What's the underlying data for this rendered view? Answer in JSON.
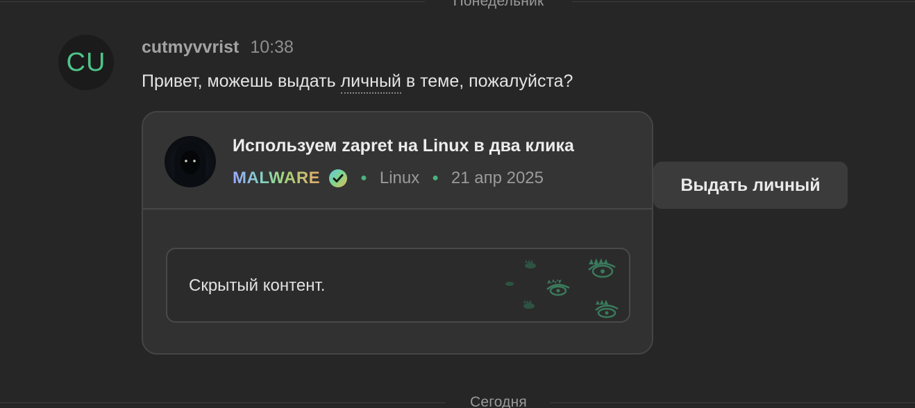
{
  "dividers": {
    "top": "Понедельник",
    "bottom": "Сегодня"
  },
  "message": {
    "avatar_initials": "CU",
    "author": "cutmyvvrist",
    "time": "10:38",
    "text_before": "Привет, можешь выдать ",
    "text_highlight": "личный",
    "text_after": " в теме, пожалуйста?"
  },
  "thread_card": {
    "title": "Используем zapret на Linux в два клика",
    "author": "MALWARE",
    "author_verified_icon": "verified-check-icon",
    "forum": "Linux",
    "date": "21 апр 2025",
    "hidden_content": "Скрытый контент.",
    "accent_color": "#4ab37e"
  },
  "action": {
    "button_label": "Выдать личный"
  }
}
